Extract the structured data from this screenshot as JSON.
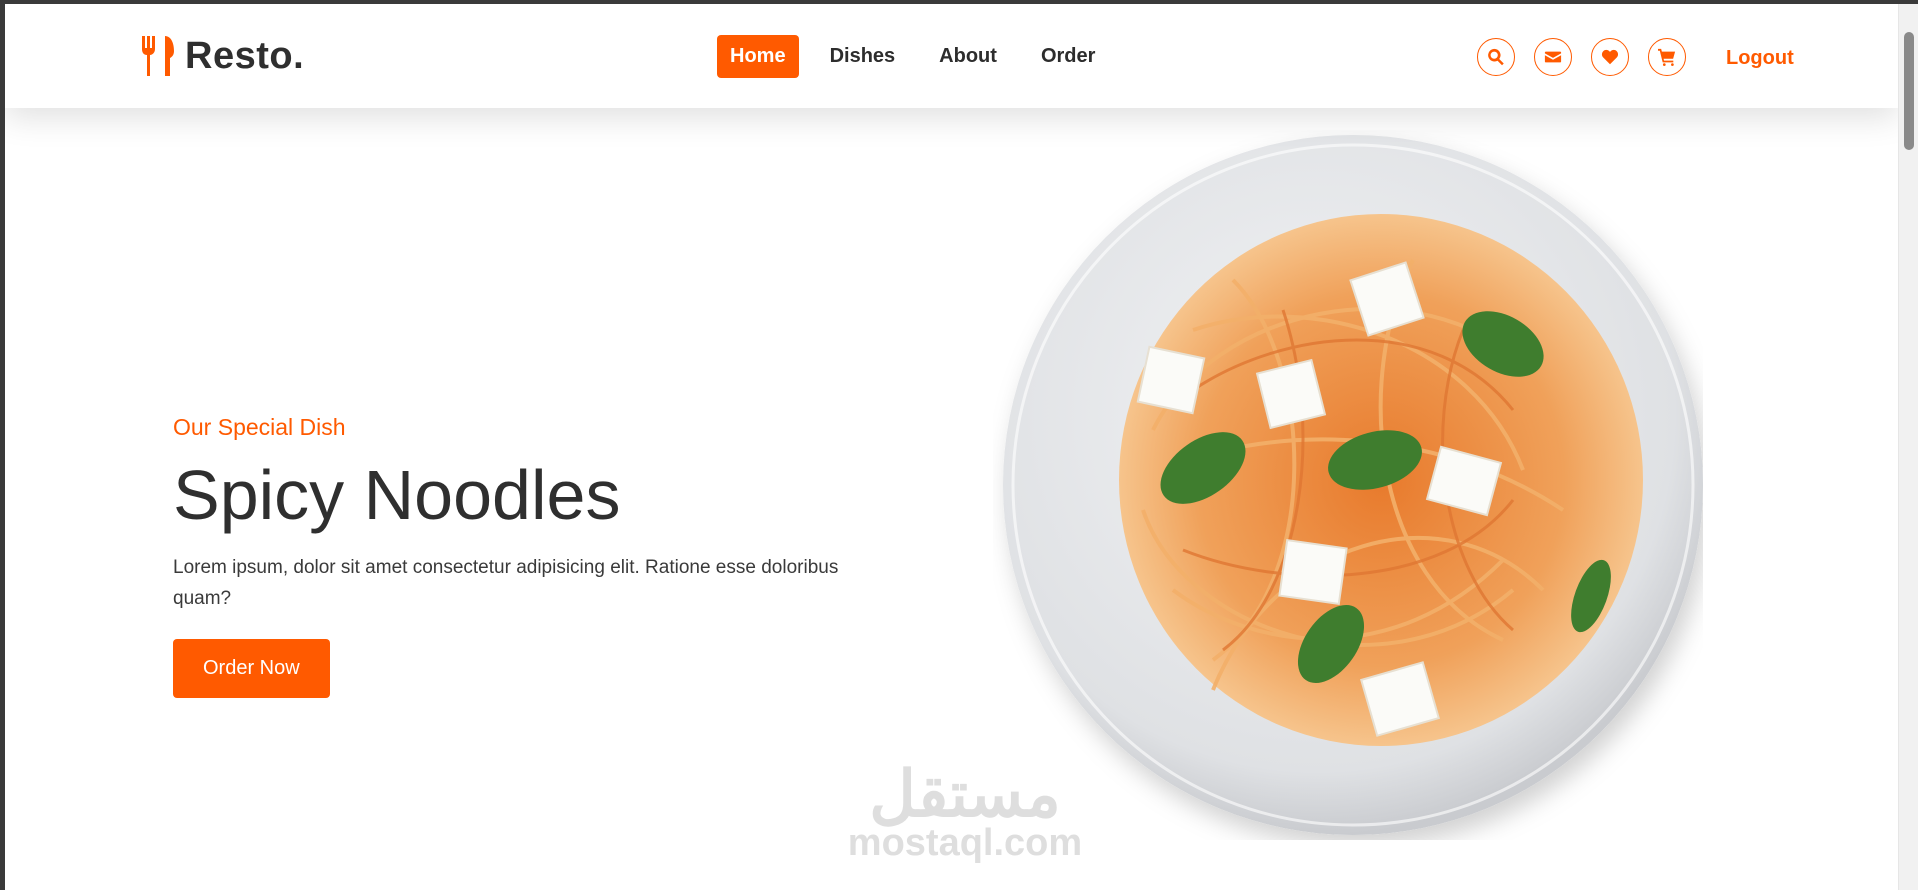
{
  "header": {
    "logo_text": "Resto.",
    "logo_icon": "utensils-icon",
    "nav": [
      {
        "label": "Home",
        "active": true
      },
      {
        "label": "Dishes",
        "active": false
      },
      {
        "label": "About",
        "active": false
      },
      {
        "label": "Order",
        "active": false
      }
    ],
    "icons": [
      "search-icon",
      "envelope-icon",
      "heart-icon",
      "cart-icon"
    ],
    "logout_label": "Logout"
  },
  "hero": {
    "subtitle": "Our Special Dish",
    "title": "Spicy Noodles",
    "description": "Lorem ipsum, dolor sit amet consectetur adipisicing elit. Ratione esse doloribus quam?",
    "button_label": "Order Now",
    "image": "spaghetti-plate"
  },
  "watermark": {
    "arabic": "مستقل",
    "latin": "mostaql.com"
  },
  "colors": {
    "accent": "#ff5a00",
    "text": "#2f2f2f"
  }
}
